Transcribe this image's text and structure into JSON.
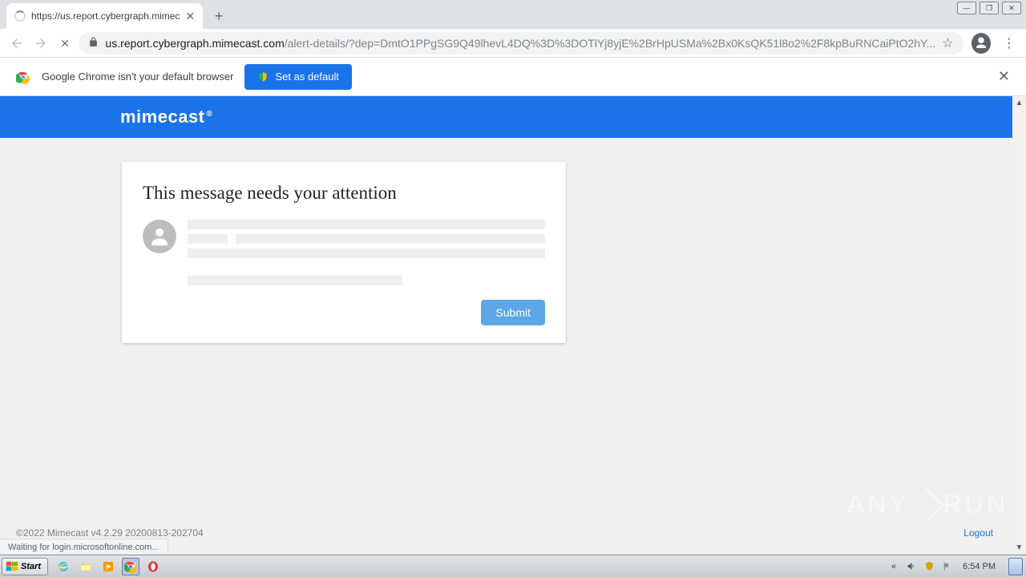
{
  "chrome": {
    "tab_title": "https://us.report.cybergraph.mimec",
    "new_tab_glyph": "+",
    "win_min": "—",
    "win_max": "❐",
    "win_close": "✕",
    "url_host": "us.report.cybergraph.mimecast.com",
    "url_path": "/alert-details/?dep=DmtO1PPgSG9Q49lhevL4DQ%3D%3DOTlYj8yjE%2BrHpUSMa%2Bx0KsQK51l8o2%2F8kpBuRNCaiPtO2hY...",
    "star_glyph": "☆",
    "menu_glyph": "⋮"
  },
  "infobar": {
    "text": "Google Chrome isn't your default browser",
    "button": "Set as default",
    "close": "✕"
  },
  "page": {
    "brand": "mimecast",
    "heading": "This message needs your attention",
    "submit": "Submit",
    "footer": "©2022 Mimecast v4.2.29 20200813-202704",
    "logout": "Logout",
    "scroll_up": "▲",
    "scroll_down": "▼"
  },
  "status": "Waiting for login.microsoftonline.com...",
  "watermark": {
    "left": "ANY",
    "right": "RUN"
  },
  "taskbar": {
    "start": "Start",
    "tray_expand": "«",
    "clock": "6:54 PM"
  }
}
